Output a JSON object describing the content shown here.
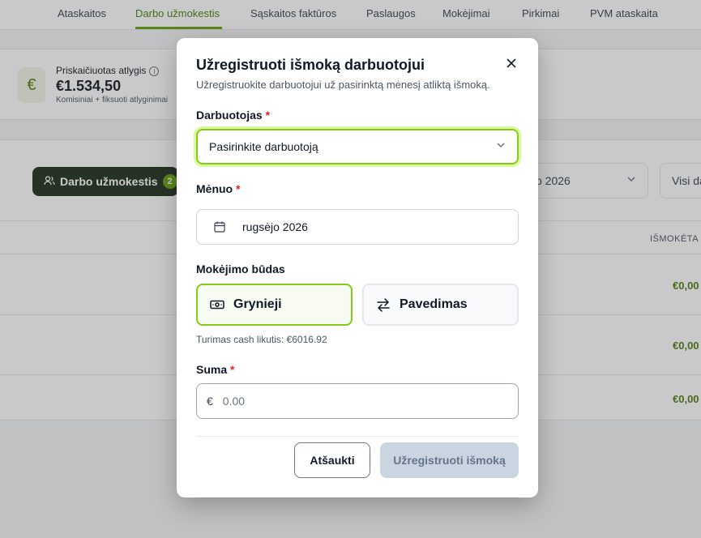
{
  "nav": {
    "tabs": [
      {
        "label": "Ataskaitos"
      },
      {
        "label": "Darbo užmokestis"
      },
      {
        "label": "Sąskaitos faktūros"
      },
      {
        "label": "Paslaugos"
      },
      {
        "label": "Mokėjimai"
      },
      {
        "label": "Pirkimai"
      },
      {
        "label": "PVM ataskaita"
      }
    ],
    "active_tab": "Darbo užmokestis"
  },
  "stat": {
    "icon_symbol": "€",
    "label": "Priskaičiuotas atlygis",
    "value": "€1.534,50",
    "sub": "Komisiniai + fiksuoti atlyginimai"
  },
  "toolbar": {
    "pill_label": "Darbo užmokestis",
    "pill_count": "2",
    "month_select": "o 2026",
    "filter": "Visi da"
  },
  "table": {
    "header": "IŠMOKĖTA",
    "rows": [
      {
        "amount": "€0,00"
      },
      {
        "amount": "€0,00"
      },
      {
        "amount": "€0,00"
      }
    ]
  },
  "modal": {
    "title": "Užregistruoti išmoką darbuotojui",
    "subtitle": "Užregistruokite darbuotojui už pasirinktą mėnesį atliktą išmoką.",
    "employee_label": "Darbuotojas",
    "employee_placeholder": "Pasirinkite darbuotoją",
    "month_label": "Mėnuo",
    "month_value": "rugsėjo 2026",
    "payment_label": "Mokėjimo būdas",
    "payment_cash": "Grynieji",
    "payment_transfer": "Pavedimas",
    "cash_balance": "Turimas cash likutis: €6016.92",
    "amount_label": "Suma",
    "currency_symbol": "€",
    "amount_placeholder": "0.00",
    "cancel_label": "Atšaukti",
    "submit_label": "Užregistruoti išmoką",
    "required_mark": "*"
  },
  "colors": {
    "accent": "#84cc16",
    "accent_dark": "#4d7c0f",
    "required": "#dc2626",
    "disabled_bg": "#cbd5e1"
  }
}
